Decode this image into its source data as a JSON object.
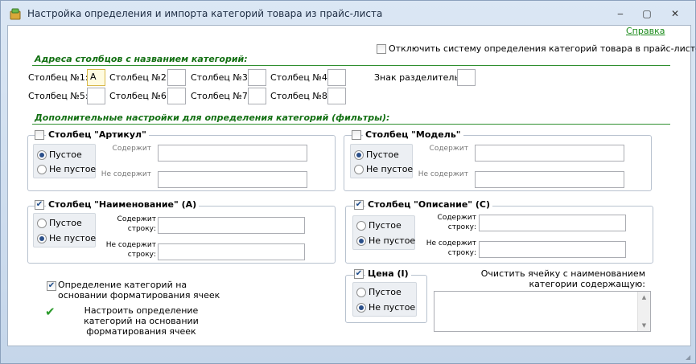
{
  "window": {
    "title": "Настройка определения и импорта категорий товара из прайс-листа",
    "minimize": "‒",
    "maximize": "▢",
    "close": "✕"
  },
  "help_link": "Справка",
  "disable_system": {
    "label": "Отключить систему определения категорий товара в прайс-листе",
    "checked": false
  },
  "addresses": {
    "title": "Адреса столбцов с названием категорий:",
    "columns": [
      {
        "label": "Столбец №1:",
        "value": "A"
      },
      {
        "label": "Столбец №2:",
        "value": ""
      },
      {
        "label": "Столбец №3:",
        "value": ""
      },
      {
        "label": "Столбец №4:",
        "value": ""
      },
      {
        "label": "Столбец №5:",
        "value": ""
      },
      {
        "label": "Столбец №6:",
        "value": ""
      },
      {
        "label": "Столбец №7:",
        "value": ""
      },
      {
        "label": "Столбец №8:",
        "value": ""
      }
    ],
    "separator_label": "Знак разделитель:",
    "separator_value": ""
  },
  "filters": {
    "title": "Дополнительные настройки для определения категорий (фильтры):",
    "article": {
      "label": "Столбец \"Артикул\"",
      "checked": false,
      "empty": "Пустое",
      "not_empty": "Не пустое",
      "selected": "empty",
      "contains": "Содержит",
      "not_contains": "Не содержит"
    },
    "model": {
      "label": "Столбец \"Модель\"",
      "checked": false,
      "empty": "Пустое",
      "not_empty": "Не пустое",
      "selected": "empty",
      "contains": "Содержит",
      "not_contains": "Не содержит"
    },
    "name": {
      "label": "Столбец \"Наименование\" (A)",
      "checked": true,
      "empty": "Пустое",
      "not_empty": "Не пустое",
      "selected": "not_empty",
      "contains": "Содержит строку:",
      "not_contains": "Не содержит строку:"
    },
    "description": {
      "label": "Столбец \"Описание\" (C)",
      "checked": true,
      "empty": "Пустое",
      "not_empty": "Не пустое",
      "selected": "not_empty",
      "contains": "Содержит строку:",
      "not_contains": "Не содержит строку:"
    },
    "price": {
      "label": "Цена (I)",
      "checked": true,
      "empty": "Пустое",
      "not_empty": "Не пустое",
      "selected": "not_empty"
    }
  },
  "format_based": {
    "label": "Определение категорий на основании форматирования ячеек",
    "checked": true
  },
  "setup_link": "Настроить определение категорий на основании форматирования ячеек",
  "clear_cell": {
    "label": "Очистить ячейку с наименованием категории содержащую:",
    "value": ""
  },
  "colors": {
    "accent": "#137013",
    "link": "#1a8a1a",
    "check": "#2a9a2a"
  }
}
